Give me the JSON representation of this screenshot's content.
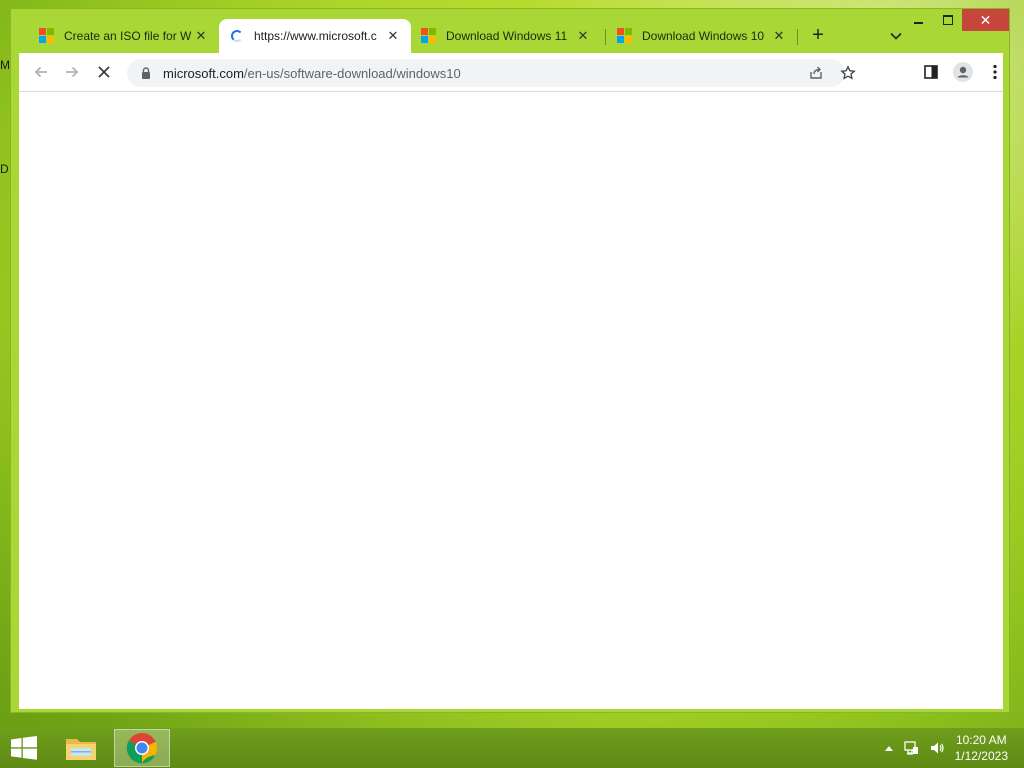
{
  "desktop": {
    "edge_letters": [
      "M",
      "D"
    ],
    "colors": {
      "wallpaper": "#b9dc2e",
      "window_frame": "#a8d736"
    }
  },
  "window": {
    "controls": {
      "minimize": "minimize",
      "maximize": "maximize",
      "close": "close"
    }
  },
  "tabs": [
    {
      "title": "Create an ISO file for W",
      "favicon": "microsoft-logo-icon",
      "active": false
    },
    {
      "title": "https://www.microsoft.c",
      "favicon": "loading-spinner-icon",
      "active": true
    },
    {
      "title": "Download Windows 11",
      "favicon": "microsoft-logo-icon",
      "active": false
    },
    {
      "title": "Download Windows 10",
      "favicon": "microsoft-logo-icon",
      "active": false
    }
  ],
  "toolbar": {
    "url_host": "microsoft.com",
    "url_path": "/en-us/software-download/windows10",
    "loading": true
  },
  "taskbar": {
    "apps": [
      {
        "name": "File Explorer",
        "icon": "folder-icon",
        "active": false
      },
      {
        "name": "Google Chrome",
        "icon": "chrome-icon",
        "active": true
      }
    ],
    "clock": {
      "time": "10:20 AM",
      "date": "1/12/2023"
    }
  }
}
